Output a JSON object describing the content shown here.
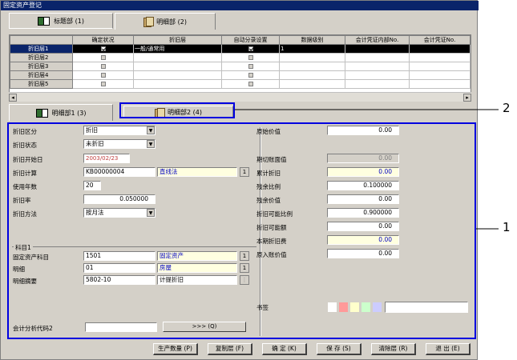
{
  "window": {
    "title": "固定资产登记"
  },
  "top_tabs": [
    {
      "label": "标题部 (1)"
    },
    {
      "label": "明细部 (2)"
    }
  ],
  "grid": {
    "columns": [
      "",
      "确定状况",
      "折旧层",
      "自动分录设置",
      "数据级别",
      "会计凭证内部No.",
      "会计凭证No."
    ],
    "rows": [
      {
        "label": "折旧层1",
        "confirmed": true,
        "layer": "一般/通常用",
        "auto": true,
        "level": "1",
        "selected": true
      },
      {
        "label": "折旧层2",
        "confirmed": false,
        "layer": "",
        "auto": false,
        "level": "",
        "selected": false
      },
      {
        "label": "折旧层3",
        "confirmed": false,
        "layer": "",
        "auto": false,
        "level": "",
        "selected": false
      },
      {
        "label": "折旧层4",
        "confirmed": false,
        "layer": "",
        "auto": false,
        "level": "",
        "selected": false
      },
      {
        "label": "折旧层5",
        "confirmed": false,
        "layer": "",
        "auto": false,
        "level": "",
        "selected": false
      }
    ]
  },
  "sub_tabs": [
    {
      "label": "明细部1 (3)"
    },
    {
      "label": "明细部2 (4)"
    }
  ],
  "left": {
    "dep_class": {
      "label": "折旧区分",
      "value": "折旧"
    },
    "dep_status": {
      "label": "折旧状态",
      "value": "未折旧"
    },
    "dep_start": {
      "label": "折旧开始日",
      "value": "2003/02/23"
    },
    "dep_calc": {
      "label": "折旧计算",
      "code": "KB00000004",
      "name": "直线法",
      "btn": "1"
    },
    "years": {
      "label": "使用年数",
      "value": "20"
    },
    "rate": {
      "label": "折旧率",
      "value": "0.050000"
    },
    "method": {
      "label": "折旧方法",
      "value": "按月法"
    },
    "section_label": "科目1",
    "account": {
      "label": "固定资产科目",
      "code": "1501",
      "name": "固定资产",
      "btn": "1"
    },
    "detail": {
      "label": "明细",
      "code": "01",
      "name": "房屋",
      "btn": "1"
    },
    "detail_summary": {
      "label": "明细摘要",
      "code": "5802-10",
      "name": "计提折旧",
      "btn": "⋮"
    },
    "analysis": {
      "label": "会计分析代码2",
      "value": "",
      "btn": ">>> (Q)"
    }
  },
  "right": {
    "orig_value": {
      "label": "原始价值",
      "value": "0.00"
    },
    "period_book": {
      "label": "期切账面值",
      "value": "0.00"
    },
    "accum_dep": {
      "label": "累计折旧",
      "value": "0.00"
    },
    "residual_ratio": {
      "label": "残余比例",
      "value": "0.100000"
    },
    "residual_value": {
      "label": "残余价值",
      "value": "0.00"
    },
    "dep_ratio": {
      "label": "折旧可能比例",
      "value": "0.900000"
    },
    "dep_amount": {
      "label": "折旧可能额",
      "value": "0.00"
    },
    "period_dep": {
      "label": "本期折旧费",
      "value": "0.00"
    },
    "book_value": {
      "label": "原入账价值",
      "value": "0.00"
    },
    "bookmark": {
      "label": "书签"
    },
    "swatch_colors": [
      "#ffffff",
      "#ff9999",
      "#ffffcc",
      "#ccffcc",
      "#ccccff"
    ]
  },
  "buttons": [
    {
      "label": "生产数量 (P)"
    },
    {
      "label": "复制层 (F)"
    },
    {
      "label": "确 定 (K)"
    },
    {
      "label": "保 存 (S)"
    },
    {
      "label": "清除层 (R)"
    },
    {
      "label": "退 出 (E)"
    }
  ],
  "callouts": [
    "2",
    "1"
  ]
}
